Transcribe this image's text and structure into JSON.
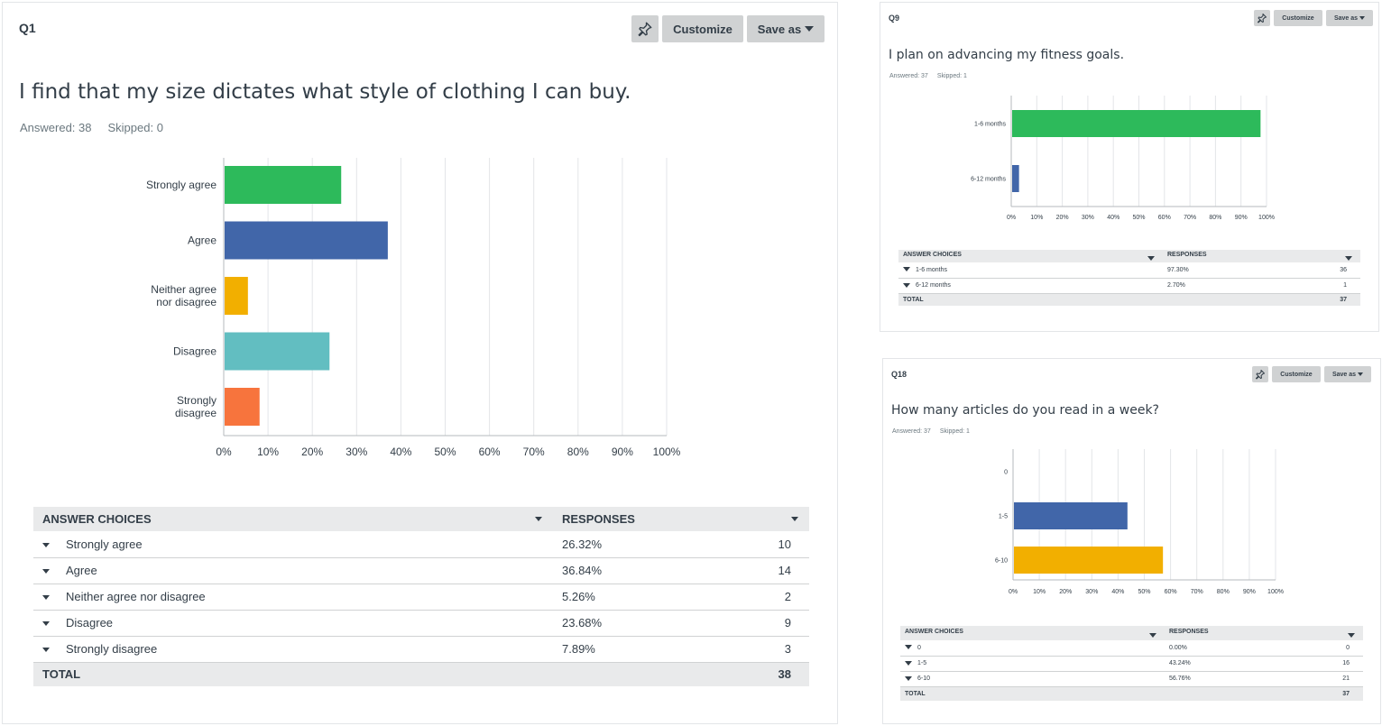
{
  "toolbar": {
    "customize_label": "Customize",
    "save_label": "Save as"
  },
  "questions": [
    {
      "number": "Q1",
      "title": "I find that my size dictates what style of clothing I can buy.",
      "answered": "Answered: 38",
      "skipped": "Skipped: 0",
      "table": {
        "col_choice": "ANSWER CHOICES",
        "col_responses": "RESPONSES",
        "rows": [
          {
            "choice": "Strongly agree",
            "percent": "26.32%",
            "count": "10"
          },
          {
            "choice": "Agree",
            "percent": "36.84%",
            "count": "14"
          },
          {
            "choice": "Neither agree nor disagree",
            "percent": "5.26%",
            "count": "2"
          },
          {
            "choice": "Disagree",
            "percent": "23.68%",
            "count": "9"
          },
          {
            "choice": "Strongly disagree",
            "percent": "7.89%",
            "count": "3"
          }
        ],
        "total_label": "TOTAL",
        "total": "38"
      }
    },
    {
      "number": "Q9",
      "title": "I plan on advancing my fitness goals.",
      "answered": "Answered: 37",
      "skipped": "Skipped: 1",
      "table": {
        "col_choice": "ANSWER CHOICES",
        "col_responses": "RESPONSES",
        "rows": [
          {
            "choice": "1-6 months",
            "percent": "97.30%",
            "count": "36"
          },
          {
            "choice": "6-12 months",
            "percent": "2.70%",
            "count": "1"
          }
        ],
        "total_label": "TOTAL",
        "total": "37"
      }
    },
    {
      "number": "Q18",
      "title": "How many articles do you read in a week?",
      "answered": "Answered: 37",
      "skipped": "Skipped: 1",
      "table": {
        "col_choice": "ANSWER CHOICES",
        "col_responses": "RESPONSES",
        "rows": [
          {
            "choice": "0",
            "percent": "0.00%",
            "count": "0"
          },
          {
            "choice": "1-5",
            "percent": "43.24%",
            "count": "16"
          },
          {
            "choice": "6-10",
            "percent": "56.76%",
            "count": "21"
          }
        ],
        "total_label": "TOTAL",
        "total": "37"
      }
    }
  ],
  "chart_data": [
    {
      "type": "bar",
      "orientation": "horizontal",
      "categories": [
        [
          "Strongly agree"
        ],
        [
          "Agree"
        ],
        [
          "Neither agree",
          "nor disagree"
        ],
        [
          "Disagree"
        ],
        [
          "Strongly",
          "disagree"
        ]
      ],
      "values": [
        26.32,
        36.84,
        5.26,
        23.68,
        7.89
      ],
      "colors": [
        "#2dba5b",
        "#4166a9",
        "#f2af00",
        "#62bec1",
        "#f7743d"
      ],
      "xlim": [
        0,
        100
      ],
      "ticks": [
        "0%",
        "10%",
        "20%",
        "30%",
        "40%",
        "50%",
        "60%",
        "70%",
        "80%",
        "90%",
        "100%"
      ],
      "grid": true
    },
    {
      "type": "bar",
      "orientation": "horizontal",
      "categories": [
        [
          "1-6 months"
        ],
        [
          "6-12 months"
        ]
      ],
      "values": [
        97.3,
        2.7
      ],
      "colors": [
        "#2dba5b",
        "#4166a9"
      ],
      "xlim": [
        0,
        100
      ],
      "ticks": [
        "0%",
        "10%",
        "20%",
        "30%",
        "40%",
        "50%",
        "60%",
        "70%",
        "80%",
        "90%",
        "100%"
      ],
      "grid": true
    },
    {
      "type": "bar",
      "orientation": "horizontal",
      "categories": [
        [
          "0"
        ],
        [
          "1-5"
        ],
        [
          "6-10"
        ]
      ],
      "values": [
        0,
        43.24,
        56.76
      ],
      "colors": [
        "#2dba5b",
        "#4166a9",
        "#f2af00"
      ],
      "xlim": [
        0,
        100
      ],
      "ticks": [
        "0%",
        "10%",
        "20%",
        "30%",
        "40%",
        "50%",
        "60%",
        "70%",
        "80%",
        "90%",
        "100%"
      ],
      "grid": true
    }
  ]
}
